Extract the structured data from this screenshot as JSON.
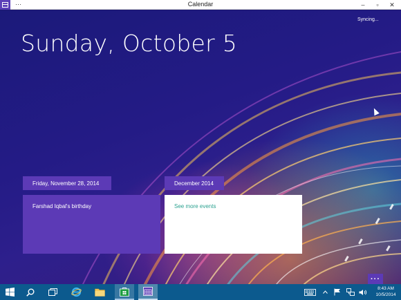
{
  "window": {
    "title": "Calendar",
    "menu_label": "···",
    "minimize_label": "–",
    "maximize_label": "▫",
    "close_label": "✕"
  },
  "header": {
    "date": "Sunday, October 5",
    "sync_status": "Syncing..."
  },
  "agenda": {
    "groups": [
      {
        "heading": "Friday, November 28, 2014",
        "event": "Farshad Iqbal's birthday"
      },
      {
        "heading": "December 2014",
        "link": "See more events"
      }
    ]
  },
  "app_bar": {
    "more_label": "···"
  },
  "taskbar": {
    "items": [
      {
        "name": "start",
        "icon": "windows-logo-icon"
      },
      {
        "name": "search",
        "icon": "search-icon"
      },
      {
        "name": "task-view",
        "icon": "task-view-icon"
      },
      {
        "name": "internet-explorer",
        "icon": "ie-icon"
      },
      {
        "name": "file-explorer",
        "icon": "folder-icon"
      },
      {
        "name": "store",
        "icon": "store-icon"
      },
      {
        "name": "calendar",
        "icon": "calendar-icon"
      }
    ],
    "clock": {
      "time": "8:43 AM",
      "date": "10/5/2014"
    }
  },
  "colors": {
    "accent": "#5c3ab6",
    "link": "#2aa18f",
    "taskbar": "#0c5a8e"
  }
}
